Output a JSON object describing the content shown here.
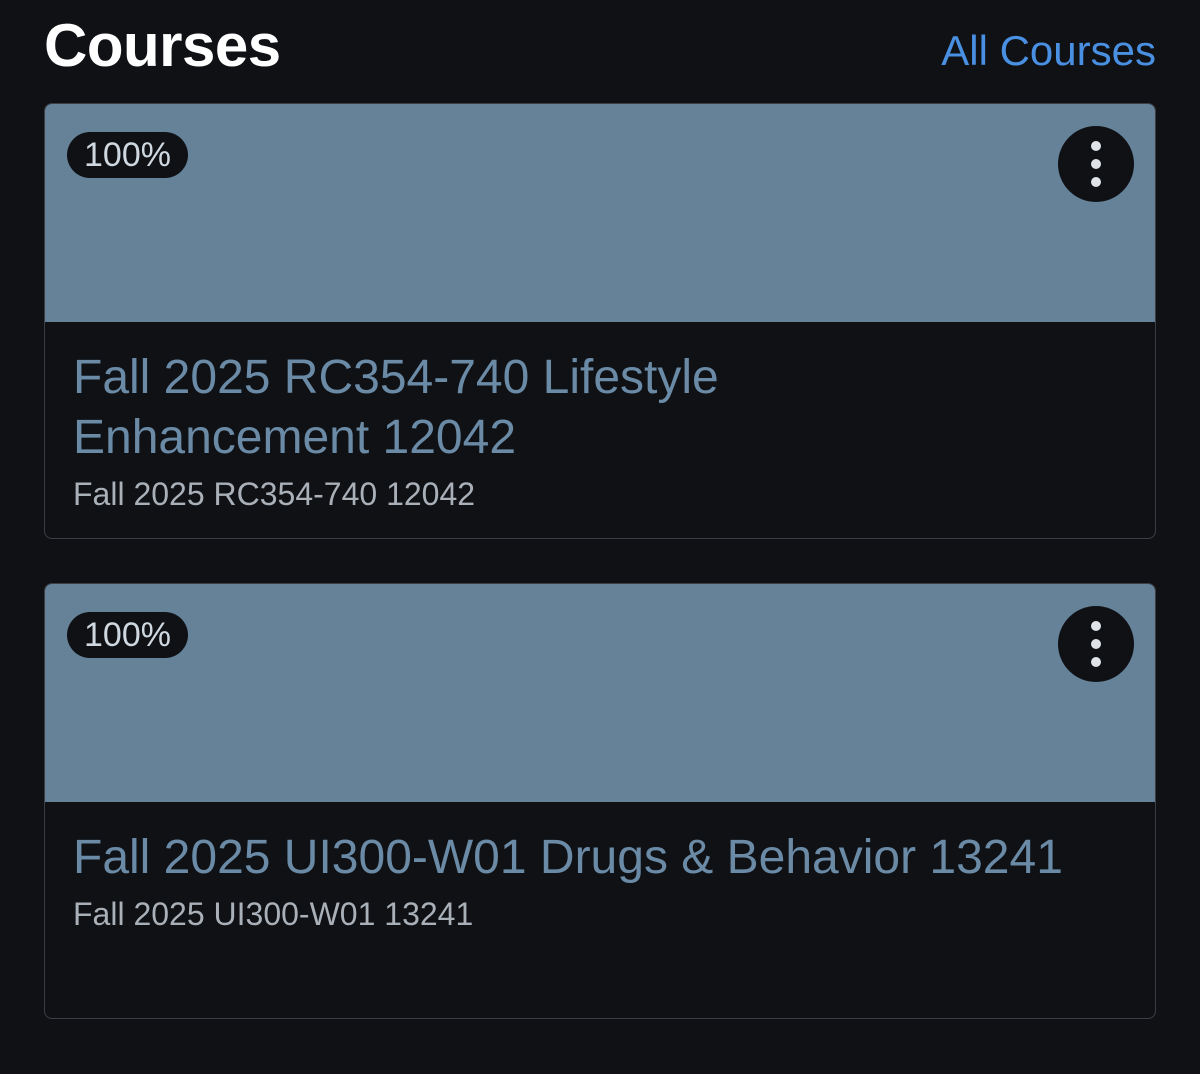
{
  "header": {
    "title": "Courses",
    "all_courses_link": "All Courses"
  },
  "courses": [
    {
      "progress": "100%",
      "title": "Fall 2025 RC354-740 Lifestyle Enhancement 12042",
      "subtitle": "Fall 2025 RC354-740 12042",
      "banner_color": "#658298"
    },
    {
      "progress": "100%",
      "title": "Fall 2025 UI300-W01 Drugs & Behavior 13241",
      "subtitle": "Fall 2025 UI300-W01 13241",
      "banner_color": "#658298"
    }
  ],
  "colors": {
    "background": "#0f1115",
    "link": "#4a90e2",
    "course_title": "#6a8aa6"
  },
  "icons": {
    "card_menu": "kebab-menu-icon"
  }
}
